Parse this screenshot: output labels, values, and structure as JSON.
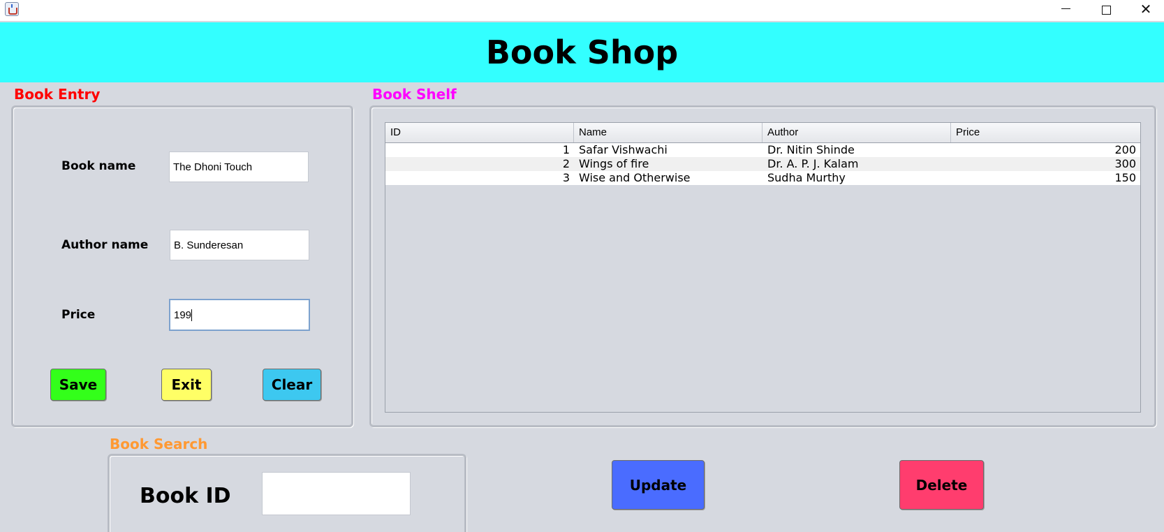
{
  "window": {
    "icon": "java-app-icon",
    "controls": {
      "minimize": "minimize-icon",
      "maximize": "maximize-icon",
      "close": "✕"
    }
  },
  "header": {
    "title": "Book Shop",
    "background": "#33ffff"
  },
  "book_entry": {
    "label": "Book Entry",
    "label_color": "#ff0000",
    "fields": {
      "book_name": {
        "label": "Book name",
        "value": "The Dhoni Touch"
      },
      "author_name": {
        "label": "Author name",
        "value": "B. Sunderesan"
      },
      "price": {
        "label": "Price",
        "value": "199"
      }
    },
    "buttons": {
      "save": {
        "label": "Save",
        "color": "#33ff1a"
      },
      "exit": {
        "label": "Exit",
        "color": "#ffff66"
      },
      "clear": {
        "label": "Clear",
        "color": "#3dc8f0"
      }
    }
  },
  "book_shelf": {
    "label": "Book Shelf",
    "label_color": "#ff00ff",
    "columns": [
      "ID",
      "Name",
      "Author",
      "Price"
    ],
    "rows": [
      {
        "id": "1",
        "name": "Safar Vishwachi",
        "author": "Dr. Nitin Shinde",
        "price": "200"
      },
      {
        "id": "2",
        "name": "Wings of fire",
        "author": "Dr. A. P. J. Kalam",
        "price": "300"
      },
      {
        "id": "3",
        "name": "Wise and Otherwise",
        "author": "Sudha Murthy",
        "price": "150"
      }
    ]
  },
  "book_search": {
    "label": "Book Search",
    "label_color": "#ff9933",
    "field_label": "Book ID",
    "value": ""
  },
  "actions": {
    "update": {
      "label": "Update",
      "color": "#4a6cff"
    },
    "delete": {
      "label": "Delete",
      "color": "#ff3d6e"
    }
  }
}
